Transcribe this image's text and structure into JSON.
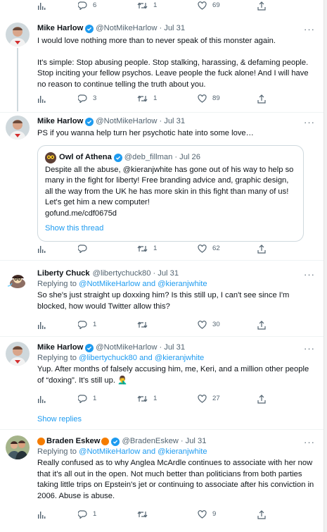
{
  "top_actions": {
    "views": "",
    "replies": "6",
    "retweets": "1",
    "likes": "69"
  },
  "tweets": [
    {
      "name": "Mike Harlow",
      "handle": "@NotMikeHarlow",
      "date": "Jul 31",
      "text": "I would love nothing more than to never speak of this monster again.\n\nIt's simple: Stop abusing people. Stop stalking, harassing, & defaming people. Stop inciting your fellow psychos. Leave people the fuck alone! And I will have no reason to continue telling the truth about you.",
      "replies": "3",
      "retweets": "1",
      "likes": "89"
    },
    {
      "name": "Mike Harlow",
      "handle": "@NotMikeHarlow",
      "date": "Jul 31",
      "text": "PS if you wanna help turn her psychotic hate into some love…",
      "quote": {
        "name": "Owl of Athena",
        "handle": "@deb_fillman",
        "date": "Jul 26",
        "text": "Despite all the abuse, @kieranjwhite has gone out of his way to help so many in the fight for liberty! Free branding advice and, graphic design, all the way from the UK he has more skin in this fight than many of us! Let's get him a new computer!",
        "link": "gofund.me/cdf0675d",
        "show_thread": "Show this thread"
      },
      "replies": "",
      "retweets": "1",
      "likes": "62"
    },
    {
      "name": "Liberty Chuck",
      "handle": "@libertychuck80",
      "date": "Jul 31",
      "replying_prefix": "Replying to ",
      "replying_to": "@NotMikeHarlow and @kieranjwhite",
      "text": "So she's just straight up doxxing him? Is this still up, I can't see since I'm blocked, how would Twitter allow this?",
      "replies": "1",
      "retweets": "",
      "likes": "30"
    },
    {
      "name": "Mike Harlow",
      "handle": "@NotMikeHarlow",
      "date": "Jul 31",
      "replying_prefix": "Replying to ",
      "replying_to": "@libertychuck80 and @kieranjwhite",
      "text": "Yup. After months of falsely accusing him, me, Keri, and a million other people of “doxing”. It's still up. 🤦‍♂️",
      "replies": "1",
      "retweets": "1",
      "likes": "27"
    },
    {
      "show_replies": "Show replies"
    },
    {
      "name": "Braden Eskew",
      "handle": "@BradenEskew",
      "date": "Jul 31",
      "replying_prefix": "Replying to ",
      "replying_to": "@NotMikeHarlow and @kieranjwhite",
      "text": "Really confused as to why Anglea McArdle continues to associate with her now that it's all out in the open. Not much better than politicians from both parties taking little trips on Epstein's jet or continuing to associate after his conviction in 2006. Abuse is abuse.",
      "replies": "1",
      "retweets": "",
      "likes": "9"
    }
  ],
  "sep": "·",
  "more": "···",
  "colors": {
    "accent": "#1d9bf0",
    "muted": "#536471",
    "text": "#0f1419",
    "border": "#eff3f4"
  }
}
